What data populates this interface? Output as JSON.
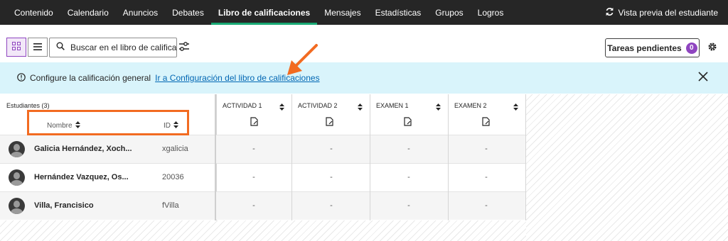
{
  "nav": {
    "items": [
      "Contenido",
      "Calendario",
      "Anuncios",
      "Debates",
      "Libro de calificaciones",
      "Mensajes",
      "Estadísticas",
      "Grupos",
      "Logros"
    ],
    "active_index": 4,
    "preview_label": "Vista previa del estudiante",
    "preview_icon": "refresh-icon"
  },
  "toolbar": {
    "grid_view_icon": "grid-view-icon",
    "list_view_icon": "list-view-icon",
    "search_placeholder": "Buscar en el libro de calificaciones",
    "filter_icon": "filter-icon",
    "pending_label": "Tareas pendientes",
    "pending_count": "0",
    "settings_icon": "gear-icon"
  },
  "banner": {
    "text": "Configure la calificación general",
    "link": "Ir a Configuración del libro de calificaciones",
    "info_icon": "info-icon",
    "close_icon": "close-icon"
  },
  "grid": {
    "students_label": "Estudiantes (3)",
    "sort_name": "Nombre",
    "sort_id": "ID",
    "columns": [
      "ACTIVIDAD 1",
      "ACTIVIDAD 2",
      "EXAMEN 1",
      "EXAMEN 2"
    ],
    "rows": [
      {
        "name": "Galicia Hernández, Xoch...",
        "id": "xgalicia",
        "cells": [
          "-",
          "-",
          "-",
          "-"
        ]
      },
      {
        "name": "Hernández Vazquez, Os...",
        "id": "20036",
        "cells": [
          "-",
          "-",
          "-",
          "-"
        ]
      },
      {
        "name": "Villa, Francisico",
        "id": "fVilla",
        "cells": [
          "-",
          "-",
          "-",
          "-"
        ]
      }
    ]
  },
  "colors": {
    "nav_bg": "#262626",
    "active_underline": "#19a974",
    "accent_purple": "#8f45c0",
    "banner_bg": "#d9f4fb",
    "annotation": "#f26b21"
  }
}
